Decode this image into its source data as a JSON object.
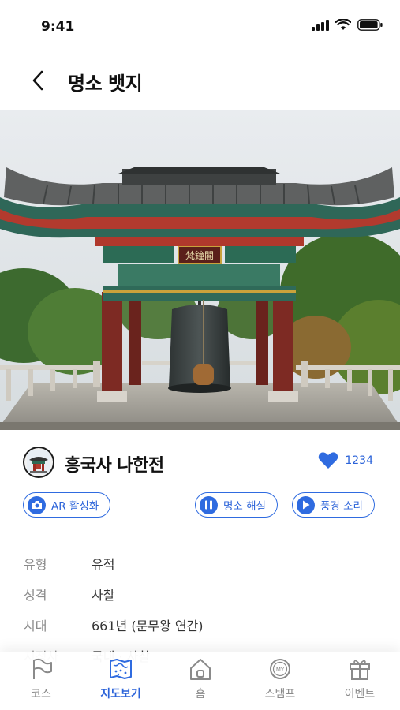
{
  "status": {
    "time": "9:41"
  },
  "header": {
    "title": "명소 뱃지"
  },
  "hero": {
    "plaque_text": "梵鐘閣"
  },
  "place": {
    "name": "흥국사 나한전",
    "like_count": "1234"
  },
  "actions": [
    {
      "label": "AR 활성화",
      "icon": "camera-icon"
    },
    {
      "label": "명소 해설",
      "icon": "pause-icon"
    },
    {
      "label": "풍경 소리",
      "icon": "play-icon"
    }
  ],
  "info": [
    {
      "key": "유형",
      "value": "유적"
    },
    {
      "key": "성격",
      "value": "사찰"
    },
    {
      "key": "시대",
      "value": "661년 (문무왕 연간)"
    },
    {
      "key": "지정사",
      "value": "국내 · 사찰"
    }
  ],
  "tabs": [
    {
      "label": "코스",
      "icon": "flag-icon",
      "active": false
    },
    {
      "label": "지도보기",
      "icon": "map-icon",
      "active": true
    },
    {
      "label": "홈",
      "icon": "home-icon",
      "active": false
    },
    {
      "label": "스탬프",
      "icon": "stamp-icon",
      "active": false
    },
    {
      "label": "이벤트",
      "icon": "gift-icon",
      "active": false
    }
  ],
  "colors": {
    "accent": "#2f6be0",
    "text": "#111111",
    "muted": "#8a8a8a"
  }
}
